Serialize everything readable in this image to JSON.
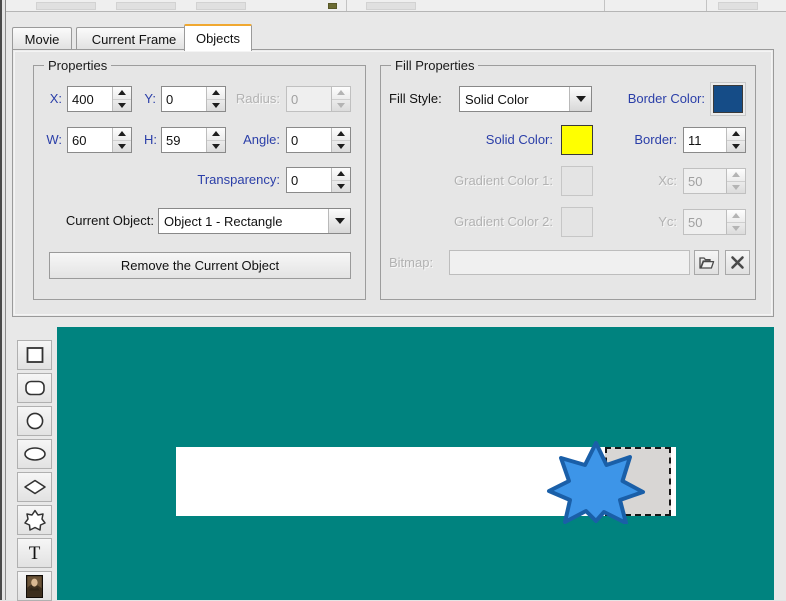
{
  "window": {
    "toolbar_truncated": true
  },
  "tabs": [
    {
      "label": "Movie",
      "active": false
    },
    {
      "label": "Current Frame",
      "active": false
    },
    {
      "label": "Objects",
      "active": true
    }
  ],
  "properties_group": {
    "legend": "Properties",
    "fields": {
      "x": {
        "label": "X:",
        "value": "400",
        "disabled": false
      },
      "y": {
        "label": "Y:",
        "value": "0",
        "disabled": false
      },
      "radius": {
        "label": "Radius:",
        "value": "0",
        "disabled": true
      },
      "w": {
        "label": "W:",
        "value": "60",
        "disabled": false
      },
      "h": {
        "label": "H:",
        "value": "59",
        "disabled": false
      },
      "angle": {
        "label": "Angle:",
        "value": "0",
        "disabled": false
      },
      "transparency": {
        "label": "Transparency:",
        "value": "0",
        "disabled": false
      }
    },
    "current_object": {
      "label": "Current Object:",
      "value": "Object 1 - Rectangle",
      "options": [
        "Object 1 - Rectangle"
      ]
    },
    "remove_button": "Remove the Current Object"
  },
  "fill_group": {
    "legend": "Fill Properties",
    "fill_style": {
      "label": "Fill Style:",
      "value": "Solid Color",
      "options": [
        "Solid Color"
      ]
    },
    "border_color": {
      "label": "Border Color:",
      "color": "#154c87",
      "disabled": false
    },
    "solid_color": {
      "label": "Solid Color:",
      "color": "#ffff00",
      "disabled": false
    },
    "border_width": {
      "label": "Border:",
      "value": "11",
      "disabled": false
    },
    "gradient_color_1": {
      "label": "Gradient Color 1:",
      "color": "#e4e4e4",
      "disabled": true
    },
    "gradient_color_2": {
      "label": "Gradient Color 2:",
      "color": "#e4e4e4",
      "disabled": true
    },
    "xc": {
      "label": "Xc:",
      "value": "50",
      "disabled": true
    },
    "yc": {
      "label": "Yc:",
      "value": "50",
      "disabled": true
    },
    "bitmap": {
      "label": "Bitmap:",
      "value": "",
      "disabled": true
    },
    "bitmap_browse_icon": "open-folder-icon",
    "bitmap_clear_icon": "clear-x-icon"
  },
  "toolbar_tools": [
    {
      "name": "rectangle-tool",
      "icon": "rectangle-icon"
    },
    {
      "name": "rounded-rectangle-tool",
      "icon": "rounded-rectangle-icon"
    },
    {
      "name": "circle-tool",
      "icon": "circle-icon"
    },
    {
      "name": "ellipse-tool",
      "icon": "ellipse-icon"
    },
    {
      "name": "diamond-tool",
      "icon": "diamond-icon"
    },
    {
      "name": "star-tool",
      "icon": "star-icon"
    },
    {
      "name": "text-tool",
      "icon": "text-t-icon",
      "glyph": "T"
    },
    {
      "name": "image-tool",
      "icon": "image-thumbnail-icon"
    }
  ],
  "canvas": {
    "background_color": "#00837f",
    "banner": {
      "color": "#ffffff"
    },
    "selected_shape": {
      "type": "rectangle",
      "fill": "#d8d6d4",
      "selection_border": "dashed-black"
    },
    "star_shape": {
      "type": "star",
      "points": 8,
      "fill": "#3d95e8",
      "stroke": "#1a5fa8"
    }
  }
}
